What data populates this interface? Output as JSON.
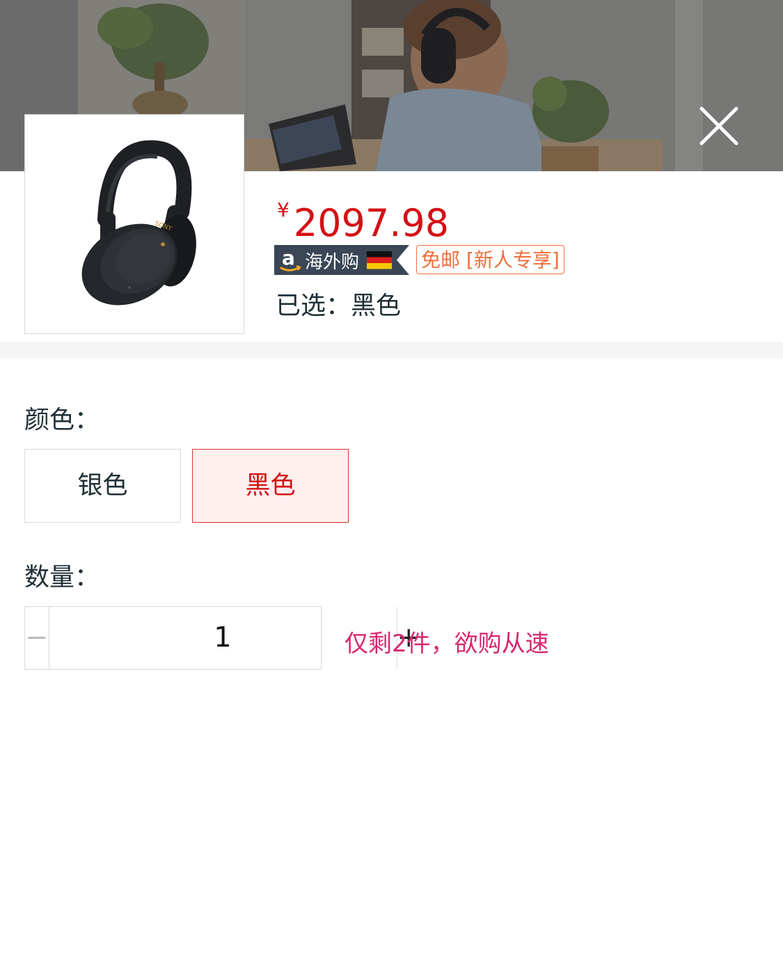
{
  "product": {
    "currency_symbol": "¥",
    "price": "2097.98",
    "amazon_badge_label": "海外购",
    "shipping_badge_label": "免邮 [新人专享]",
    "selected_label": "已选：",
    "selected_value": "黑色"
  },
  "options": {
    "color_label": "颜色：",
    "colors": [
      "银色",
      "黑色"
    ],
    "selected_color": "黑色",
    "quantity_label": "数量：",
    "quantity": "1",
    "minus_label": "−",
    "plus_label": "+",
    "stock_note": "仅剩2件，欲购从速"
  },
  "colors": {
    "price": "#d40f14",
    "shipping_badge": "#ef6e3c",
    "stock_note": "#d6286f",
    "active_option_border": "#d8342b",
    "active_option_bg": "#fdf0ef"
  },
  "icons": {
    "close": "close-icon",
    "amazon": "amazon-logo-icon",
    "flag": "germany-flag-icon",
    "product": "headphones-product-image"
  }
}
